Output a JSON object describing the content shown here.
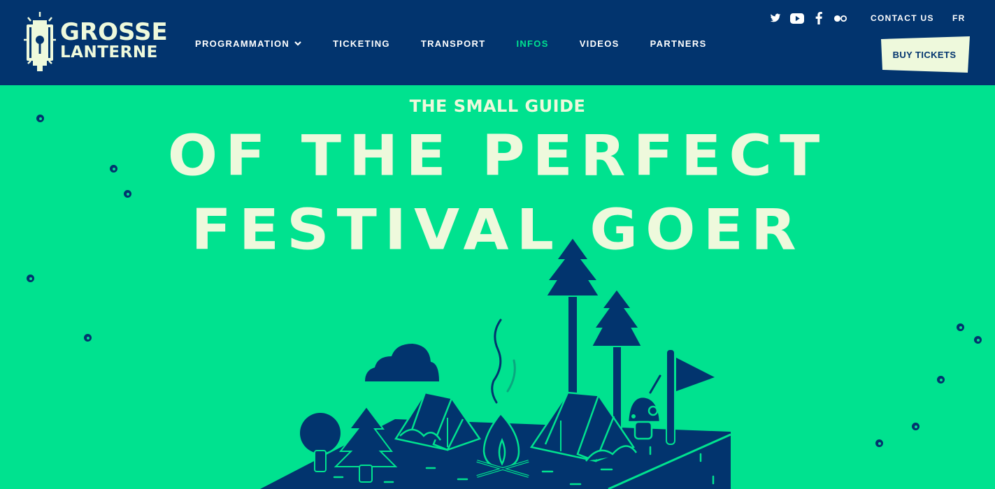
{
  "header": {
    "logo": {
      "line1": "GROSSE",
      "line2": "LANTERNE"
    },
    "nav": [
      {
        "label": "PROGRAMMATION",
        "has_dropdown": true
      },
      {
        "label": "TICKETING"
      },
      {
        "label": "TRANSPORT"
      },
      {
        "label": "INFOS",
        "active": true
      },
      {
        "label": "VIDEOS"
      },
      {
        "label": "PARTNERS"
      }
    ],
    "social_icons": [
      "twitter-icon",
      "youtube-icon",
      "facebook-icon",
      "flickr-icon"
    ],
    "contact_label": "CONTACT US",
    "lang_label": "FR",
    "buy_label": "BUY TICKETS"
  },
  "hero": {
    "subtitle": "THE SMALL GUIDE",
    "title_line1": "OF THE PERFECT",
    "title_line2": "FESTIVAL GOER"
  },
  "colors": {
    "navy": "#02346e",
    "green": "#00e28f",
    "cream": "#eef9dc",
    "active_nav": "#00e28f"
  }
}
